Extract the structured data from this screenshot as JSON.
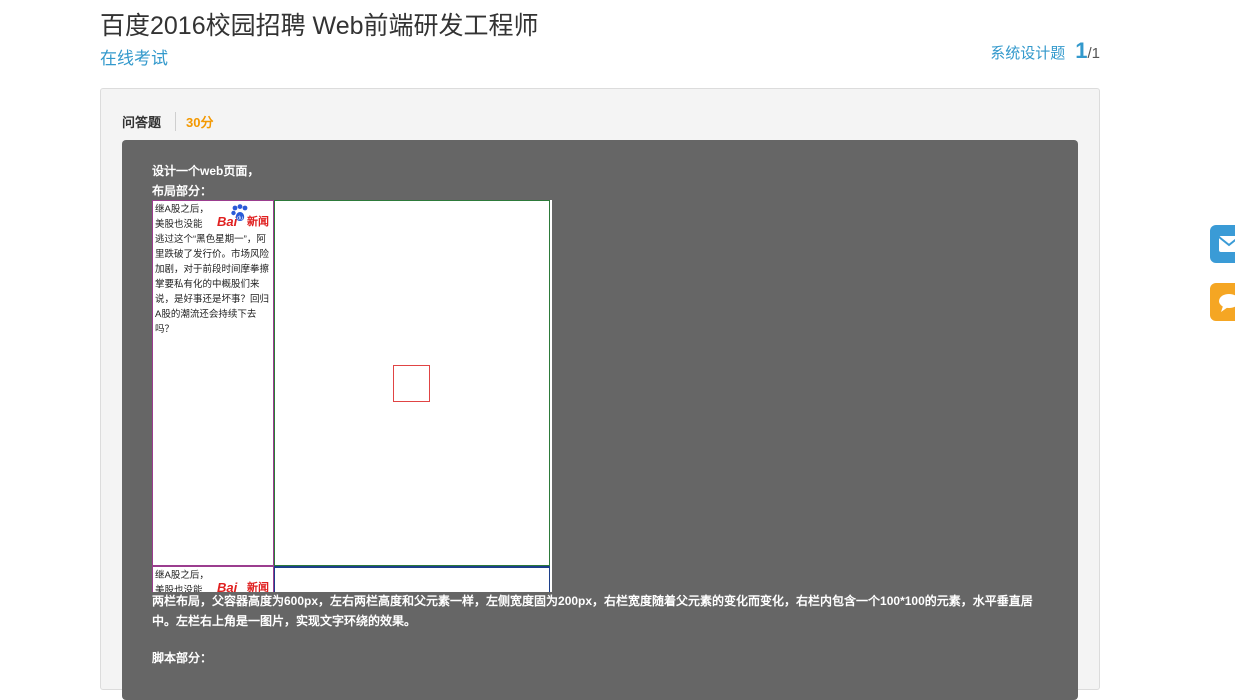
{
  "header": {
    "title": "百度2016校园招聘 Web前端研发工程师",
    "subtitle_link": "在线考试",
    "progress_label": "系统设计题",
    "progress_current": "1",
    "progress_separator": "/",
    "progress_total": "1"
  },
  "question": {
    "type_label": "问答题",
    "score": "30分",
    "line1": "设计一个web页面，",
    "line2": "布局部分：",
    "demo": {
      "left_text_row1": "继A股之后，美股也没能逃过这个“黑色星期一”，阿里跌破了发行价。市场风险加剧，对于前段时间摩拳擦掌要私有化的中概股们来说，是好事还是坏事？回归A股的潮流还会持续下去吗？",
      "left_text_row2": "继A股之后，美股也没能逃",
      "logo_text_bai": "Bai",
      "logo_text_news": "新闻"
    },
    "description": "两栏布局，父容器高度为600px，左右两栏高度和父元素一样，左侧宽度固为200px，右栏宽度随着父元素的变化而变化，右栏内包含一个100*100的元素，水平垂直居中。左栏右上角是一图片，实现文字环绕的效果。",
    "line_script": "脚本部分："
  },
  "side_buttons": {
    "mail_icon": "envelope-icon",
    "chat_icon": "chat-bubble-icon"
  },
  "colors": {
    "accent": "#3399cc",
    "score": "#f39800",
    "question_bg": "#666666",
    "mail_btn": "#3a9bd6",
    "chat_btn": "#f5a623"
  }
}
